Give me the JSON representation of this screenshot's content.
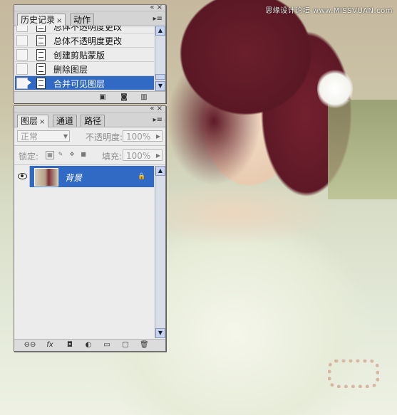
{
  "watermark": "思缘设计论坛 www.MISSVUAN.com",
  "history_panel": {
    "tabs": [
      {
        "label": "历史记录",
        "close": "×"
      },
      {
        "label": "动作"
      }
    ],
    "panel_controls": "«  ×",
    "menu_icon": "▸≡",
    "items": [
      {
        "label": "总体不透明度更改"
      },
      {
        "label": "总体不透明度更改"
      },
      {
        "label": "创建剪贴蒙版"
      },
      {
        "label": "删除图层"
      },
      {
        "label": "合并可见图层",
        "selected": true
      }
    ],
    "bottom_icons": [
      "new-document-from-state-icon",
      "snapshot-camera-icon",
      "trash-icon"
    ]
  },
  "layers_panel": {
    "tabs": [
      {
        "label": "图层",
        "close": "×"
      },
      {
        "label": "通道"
      },
      {
        "label": "路径"
      }
    ],
    "panel_controls": "«  ×",
    "blend_mode": "正常",
    "opacity_label": "不透明度:",
    "opacity_value": "100%",
    "lock_label": "锁定:",
    "fill_label": "填充:",
    "fill_value": "100%",
    "layers": [
      {
        "name": "背景",
        "visible": true,
        "locked": true,
        "selected": true
      }
    ],
    "bottom_icons": [
      "link-icon",
      "fx-icon",
      "mask-icon",
      "adjustment-layer-icon",
      "group-folder-icon",
      "new-layer-icon",
      "trash-icon"
    ],
    "bottom_labels": {
      "link": "⊖⊖",
      "fx": "fx",
      "mask": "◘",
      "adjust": "◐",
      "group": "▭",
      "new": "▢",
      "trash": "🗑"
    }
  },
  "colors": {
    "selection": "#316ac5",
    "panel_bg": "#ececec"
  }
}
